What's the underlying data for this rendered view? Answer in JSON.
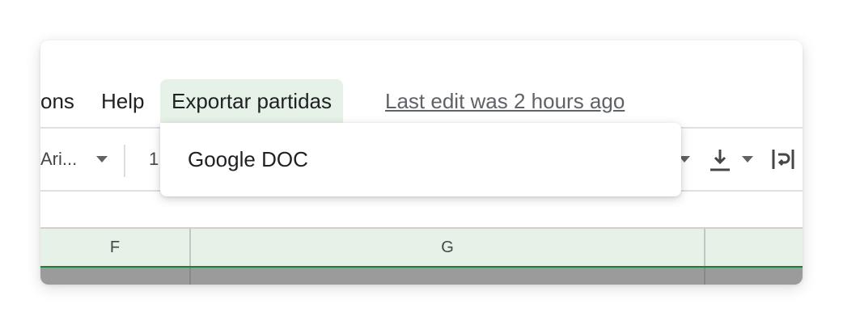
{
  "menubar": {
    "items": [
      {
        "label": "ons"
      },
      {
        "label": "Help"
      },
      {
        "label": "Exportar partidas"
      }
    ],
    "last_edit": "Last edit was 2 hours ago"
  },
  "toolbar": {
    "font_name": "Ari...",
    "font_size": "1",
    "icons": [
      "vertical-align-bottom-icon",
      "text-wrap-icon"
    ]
  },
  "columns": [
    {
      "label": "F"
    },
    {
      "label": "G"
    },
    {
      "label": ""
    }
  ],
  "dropdown": {
    "items": [
      {
        "label": "Google DOC"
      }
    ]
  },
  "colors": {
    "menu_active_bg": "#e6f2e8",
    "header_bg": "#e6f2e8",
    "header_underline": "#188038",
    "text": "#202124",
    "muted_text": "#5f6368"
  }
}
